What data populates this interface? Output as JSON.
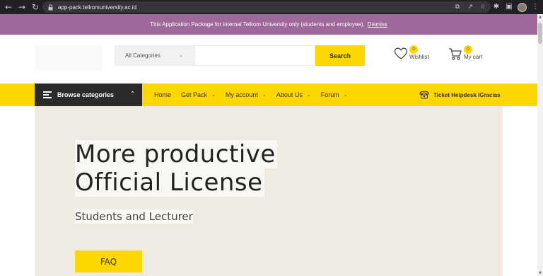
{
  "browser": {
    "url": "app-pack.telkomuniversity.ac.id",
    "back_icon": "back-arrow-icon",
    "forward_icon": "forward-arrow-icon",
    "reload_icon": "reload-icon"
  },
  "notice": {
    "text": "This Application Package for internal Telkom University only (students and employee).",
    "dismiss_label": "Dismiss"
  },
  "search": {
    "category_selected": "All Categories",
    "placeholder": "",
    "button_label": "Search"
  },
  "header": {
    "wishlist_label": "Wishlist",
    "wishlist_count": "0",
    "cart_label": "My cart",
    "cart_count": "0"
  },
  "nav": {
    "browse_label": "Browse categories",
    "items": [
      {
        "label": "Home"
      },
      {
        "label": "Get Pack"
      },
      {
        "label": "My account"
      },
      {
        "label": "About Us"
      },
      {
        "label": "Forum"
      }
    ],
    "helpdesk_label": "Ticket Helpdesk iGracias"
  },
  "hero": {
    "title_line1": "More productive",
    "title_line2": "Official License",
    "subtitle": "Students and Lecturer",
    "button_label": "FAQ"
  },
  "colors": {
    "accent": "#fed700",
    "notice_bg": "#a0679a",
    "dark": "#2b2b2b",
    "hero_bg": "#f0ebe2"
  }
}
